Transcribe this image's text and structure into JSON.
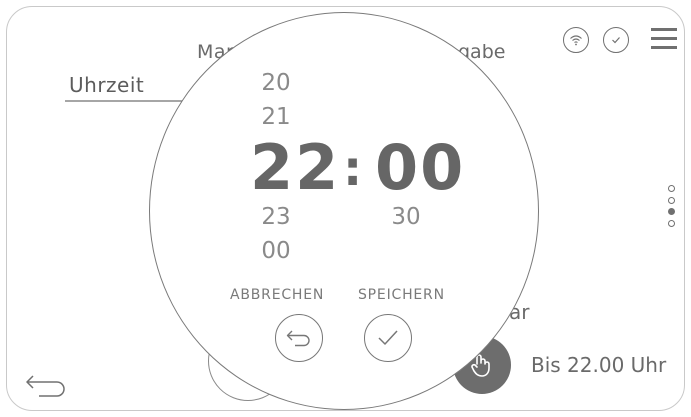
{
  "background": {
    "title_left": "Man",
    "title_right": "gabe",
    "time_label": "Uhrzeit",
    "partial_text": "ar",
    "until_text": "Bis 22.00 Uhr"
  },
  "header": {
    "wifi_icon": "wifi-icon",
    "chat_check_icon": "chat-check-icon",
    "menu_icon": "hamburger-menu-icon"
  },
  "pagination": {
    "count": 4,
    "active_index": 2
  },
  "picker": {
    "hours": {
      "above2": "20",
      "above1": "21",
      "selected": "22",
      "below1": "23",
      "below2": "00"
    },
    "minutes": {
      "selected": "00",
      "below1": "30"
    },
    "separator": ":",
    "cancel_label": "ABBRECHEN",
    "save_label": "SPEICHERN"
  },
  "colors": {
    "text": "#707070",
    "border": "#c9c9c9",
    "dark_button": "#6d6d6d"
  }
}
